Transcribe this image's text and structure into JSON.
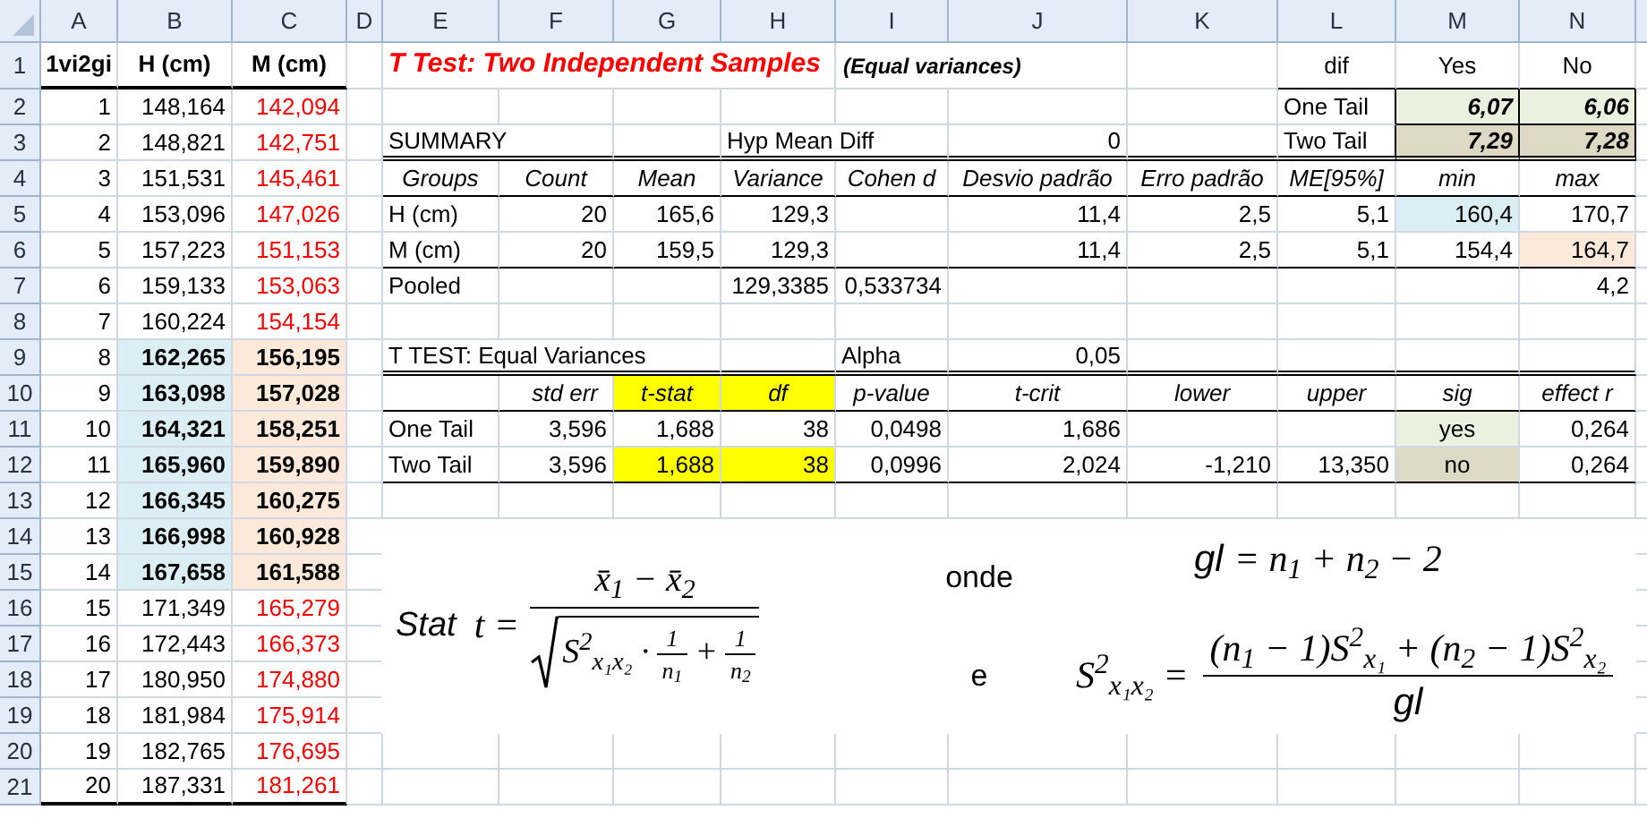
{
  "columns": [
    "A",
    "B",
    "C",
    "D",
    "E",
    "F",
    "G",
    "H",
    "I",
    "J",
    "K",
    "L",
    "M",
    "N"
  ],
  "rows": [
    {
      "label": "1",
      "cells": [
        {
          "text": "1vi2gi",
          "kind": "head"
        },
        {
          "text": "H (cm)",
          "kind": "head"
        },
        {
          "text": "M (cm)",
          "kind": "head"
        },
        null,
        {
          "text": "T Test: Two Independent Samples",
          "kind": "title"
        },
        null,
        null,
        null,
        {
          "text": "(Equal variances)",
          "kind": "subtitle"
        },
        null,
        null,
        {
          "text": "dif",
          "kind": "label"
        },
        {
          "text": "Yes",
          "kind": "label"
        },
        {
          "text": "No",
          "kind": "label"
        }
      ]
    },
    {
      "label": "2",
      "cells": [
        {
          "text": "1",
          "kind": "num"
        },
        {
          "text": "148,164",
          "kind": "num"
        },
        {
          "text": "142,094",
          "kind": "num_red"
        },
        null,
        null,
        null,
        null,
        null,
        null,
        null,
        null,
        {
          "text": "One Tail",
          "kind": "text"
        },
        {
          "text": "6,07",
          "kind": "key",
          "color": "#ebf1de"
        },
        {
          "text": "6,06",
          "kind": "key",
          "color": "#ebf1de"
        }
      ]
    },
    {
      "label": "3",
      "cells": [
        {
          "text": "2",
          "kind": "num"
        },
        {
          "text": "148,821",
          "kind": "num"
        },
        {
          "text": "142,751",
          "kind": "num_red"
        },
        null,
        {
          "text": "SUMMARY",
          "kind": "text"
        },
        null,
        null,
        {
          "text": "Hyp Mean Diff",
          "kind": "text"
        },
        null,
        {
          "text": "0",
          "kind": "num"
        },
        null,
        {
          "text": "Two Tail",
          "kind": "text"
        },
        {
          "text": "7,29",
          "kind": "key",
          "color": "#ddd9c4"
        },
        {
          "text": "7,28",
          "kind": "key",
          "color": "#ddd9c4"
        }
      ]
    },
    {
      "label": "4",
      "cells": [
        {
          "text": "3",
          "kind": "num"
        },
        {
          "text": "151,531",
          "kind": "num"
        },
        {
          "text": "145,461",
          "kind": "num_red"
        },
        null,
        {
          "text": "Groups",
          "kind": "colhead"
        },
        {
          "text": "Count",
          "kind": "colhead"
        },
        {
          "text": "Mean",
          "kind": "colhead"
        },
        {
          "text": "Variance",
          "kind": "colhead"
        },
        {
          "text": "Cohen d",
          "kind": "colhead"
        },
        {
          "text": "Desvio padrão",
          "kind": "colhead"
        },
        {
          "text": "Erro padrão",
          "kind": "colhead"
        },
        {
          "text": "ME[95%]",
          "kind": "colhead"
        },
        {
          "text": "min",
          "kind": "colhead"
        },
        {
          "text": "max",
          "kind": "colhead"
        }
      ]
    },
    {
      "label": "5",
      "cells": [
        {
          "text": "4",
          "kind": "num"
        },
        {
          "text": "153,096",
          "kind": "num"
        },
        {
          "text": "147,026",
          "kind": "num_red"
        },
        null,
        {
          "text": "H (cm)",
          "kind": "text"
        },
        {
          "text": "20",
          "kind": "num"
        },
        {
          "text": "165,6",
          "kind": "num"
        },
        {
          "text": "129,3",
          "kind": "num"
        },
        null,
        {
          "text": "11,4",
          "kind": "num"
        },
        {
          "text": "2,5",
          "kind": "num"
        },
        {
          "text": "5,1",
          "kind": "num"
        },
        {
          "text": "160,4",
          "kind": "num",
          "color": "#daeef3"
        },
        {
          "text": "170,7",
          "kind": "num"
        }
      ]
    },
    {
      "label": "6",
      "cells": [
        {
          "text": "5",
          "kind": "num"
        },
        {
          "text": "157,223",
          "kind": "num"
        },
        {
          "text": "151,153",
          "kind": "num_red"
        },
        null,
        {
          "text": "M (cm)",
          "kind": "text"
        },
        {
          "text": "20",
          "kind": "num"
        },
        {
          "text": "159,5",
          "kind": "num"
        },
        {
          "text": "129,3",
          "kind": "num"
        },
        null,
        {
          "text": "11,4",
          "kind": "num"
        },
        {
          "text": "2,5",
          "kind": "num"
        },
        {
          "text": "5,1",
          "kind": "num"
        },
        {
          "text": "154,4",
          "kind": "num"
        },
        {
          "text": "164,7",
          "kind": "num",
          "color": "#fde9d9"
        }
      ]
    },
    {
      "label": "7",
      "cells": [
        {
          "text": "6",
          "kind": "num"
        },
        {
          "text": "159,133",
          "kind": "num"
        },
        {
          "text": "153,063",
          "kind": "num_red"
        },
        null,
        {
          "text": "Pooled",
          "kind": "text"
        },
        null,
        null,
        {
          "text": "129,3385",
          "kind": "num"
        },
        {
          "text": "0,533734",
          "kind": "num"
        },
        null,
        null,
        null,
        null,
        {
          "text": "4,2",
          "kind": "num"
        }
      ]
    },
    {
      "label": "8",
      "cells": [
        {
          "text": "7",
          "kind": "num"
        },
        {
          "text": "160,224",
          "kind": "num"
        },
        {
          "text": "154,154",
          "kind": "num_red"
        },
        null,
        null,
        null,
        null,
        null,
        null,
        null,
        null,
        null,
        null,
        null
      ]
    },
    {
      "label": "9",
      "cells": [
        {
          "text": "8",
          "kind": "num"
        },
        {
          "text": "162,265",
          "kind": "num_bold",
          "color": "#daeef3"
        },
        {
          "text": "156,195",
          "kind": "num_bold",
          "color": "#fde9d9"
        },
        null,
        {
          "text": "T TEST: Equal Variances",
          "kind": "text"
        },
        null,
        null,
        null,
        {
          "text": "Alpha",
          "kind": "text"
        },
        {
          "text": "0,05",
          "kind": "num"
        },
        null,
        null,
        null,
        null
      ]
    },
    {
      "label": "10",
      "cells": [
        {
          "text": "9",
          "kind": "num"
        },
        {
          "text": "163,098",
          "kind": "num_bold",
          "color": "#daeef3"
        },
        {
          "text": "157,028",
          "kind": "num_bold",
          "color": "#fde9d9"
        },
        null,
        null,
        {
          "text": "std err",
          "kind": "colhead_right"
        },
        {
          "text": "t-stat",
          "kind": "colhead",
          "color": "#ffff00"
        },
        {
          "text": "df",
          "kind": "colhead",
          "color": "#ffff00"
        },
        {
          "text": "p-value",
          "kind": "colhead"
        },
        {
          "text": "t-crit",
          "kind": "colhead"
        },
        {
          "text": "lower",
          "kind": "colhead"
        },
        {
          "text": "upper",
          "kind": "colhead"
        },
        {
          "text": "sig",
          "kind": "colhead"
        },
        {
          "text": "effect r",
          "kind": "colhead"
        }
      ]
    },
    {
      "label": "11",
      "cells": [
        {
          "text": "10",
          "kind": "num"
        },
        {
          "text": "164,321",
          "kind": "num_bold",
          "color": "#daeef3"
        },
        {
          "text": "158,251",
          "kind": "num_bold",
          "color": "#fde9d9"
        },
        null,
        {
          "text": "One Tail",
          "kind": "text"
        },
        {
          "text": "3,596",
          "kind": "num"
        },
        {
          "text": "1,688",
          "kind": "num"
        },
        {
          "text": "38",
          "kind": "num"
        },
        {
          "text": "0,0498",
          "kind": "num"
        },
        {
          "text": "1,686",
          "kind": "num"
        },
        null,
        null,
        {
          "text": "yes",
          "kind": "label",
          "color": "#ebf1de"
        },
        {
          "text": "0,264",
          "kind": "num"
        }
      ]
    },
    {
      "label": "12",
      "cells": [
        {
          "text": "11",
          "kind": "num"
        },
        {
          "text": "165,960",
          "kind": "num_bold",
          "color": "#daeef3"
        },
        {
          "text": "159,890",
          "kind": "num_bold",
          "color": "#fde9d9"
        },
        null,
        {
          "text": "Two Tail",
          "kind": "text"
        },
        {
          "text": "3,596",
          "kind": "num"
        },
        {
          "text": "1,688",
          "kind": "num",
          "color": "#ffff00"
        },
        {
          "text": "38",
          "kind": "num",
          "color": "#ffff00"
        },
        {
          "text": "0,0996",
          "kind": "num"
        },
        {
          "text": "2,024",
          "kind": "num"
        },
        {
          "text": "-1,210",
          "kind": "num"
        },
        {
          "text": "13,350",
          "kind": "num"
        },
        {
          "text": "no",
          "kind": "label",
          "color": "#ddd9c4"
        },
        {
          "text": "0,264",
          "kind": "num"
        }
      ]
    },
    {
      "label": "13",
      "cells": [
        {
          "text": "12",
          "kind": "num"
        },
        {
          "text": "166,345",
          "kind": "num_bold",
          "color": "#daeef3"
        },
        {
          "text": "160,275",
          "kind": "num_bold",
          "color": "#fde9d9"
        },
        null,
        null,
        null,
        null,
        null,
        null,
        null,
        null,
        null,
        null,
        null
      ]
    },
    {
      "label": "14",
      "cells": [
        {
          "text": "13",
          "kind": "num"
        },
        {
          "text": "166,998",
          "kind": "num_bold",
          "color": "#daeef3"
        },
        {
          "text": "160,928",
          "kind": "num_bold",
          "color": "#fde9d9"
        },
        null,
        null,
        null,
        null,
        null,
        null,
        null,
        null,
        null,
        null,
        null
      ]
    },
    {
      "label": "15",
      "cells": [
        {
          "text": "14",
          "kind": "num"
        },
        {
          "text": "167,658",
          "kind": "num_bold",
          "color": "#daeef3"
        },
        {
          "text": "161,588",
          "kind": "num_bold",
          "color": "#fde9d9"
        },
        null,
        null,
        null,
        null,
        null,
        null,
        null,
        null,
        null,
        null,
        null
      ]
    },
    {
      "label": "16",
      "cells": [
        {
          "text": "15",
          "kind": "num"
        },
        {
          "text": "171,349",
          "kind": "num"
        },
        {
          "text": "165,279",
          "kind": "num_red"
        },
        null,
        null,
        null,
        null,
        null,
        null,
        null,
        null,
        null,
        null,
        null
      ]
    },
    {
      "label": "17",
      "cells": [
        {
          "text": "16",
          "kind": "num"
        },
        {
          "text": "172,443",
          "kind": "num"
        },
        {
          "text": "166,373",
          "kind": "num_red"
        },
        null,
        null,
        null,
        null,
        null,
        null,
        null,
        null,
        null,
        null,
        null
      ]
    },
    {
      "label": "18",
      "cells": [
        {
          "text": "17",
          "kind": "num"
        },
        {
          "text": "180,950",
          "kind": "num"
        },
        {
          "text": "174,880",
          "kind": "num_red"
        },
        null,
        null,
        null,
        null,
        null,
        null,
        null,
        null,
        null,
        null,
        null
      ]
    },
    {
      "label": "19",
      "cells": [
        {
          "text": "18",
          "kind": "num"
        },
        {
          "text": "181,984",
          "kind": "num"
        },
        {
          "text": "175,914",
          "kind": "num_red"
        },
        null,
        null,
        null,
        null,
        null,
        null,
        null,
        null,
        null,
        null,
        null
      ]
    },
    {
      "label": "20",
      "cells": [
        {
          "text": "19",
          "kind": "num"
        },
        {
          "text": "182,765",
          "kind": "num"
        },
        {
          "text": "176,695",
          "kind": "num_red"
        },
        null,
        null,
        null,
        null,
        null,
        null,
        null,
        null,
        null,
        null,
        null
      ]
    },
    {
      "label": "21",
      "cells": [
        {
          "text": "20",
          "kind": "num"
        },
        {
          "text": "187,331",
          "kind": "num"
        },
        {
          "text": "181,261",
          "kind": "num_red"
        },
        null,
        null,
        null,
        null,
        null,
        null,
        null,
        null,
        null,
        null,
        null
      ]
    }
  ],
  "formulas": {
    "t_stat": {
      "label": "Stat",
      "lhs": "t =",
      "numerator": "x̄$_{1}$ − x̄$_{2}$",
      "denominator": {
        "term": "S$^{2}$$_{x₁x₂}$ ·",
        "fraction_1": {
          "numerator": "1",
          "denominator": "n$_{1}$"
        },
        "operator": "+",
        "fraction_2": {
          "numerator": "1",
          "denominator": "n$_{2}$"
        }
      }
    },
    "connector_1": "onde",
    "df": {
      "lhs": "gl",
      "rhs": "= n$_{1}$ + n$_{2}$ − 2"
    },
    "connector_2": "e",
    "pooled_variance": {
      "lhs": "S$^{2}$$_{x₁x₂}$ =",
      "numerator": "(n$_{1}$ − 1)S$^{2}$$_{x₁}$ + (n$_{2}$ − 1)S$^{2}$$_{x₂}$",
      "denominator": "gl"
    }
  }
}
